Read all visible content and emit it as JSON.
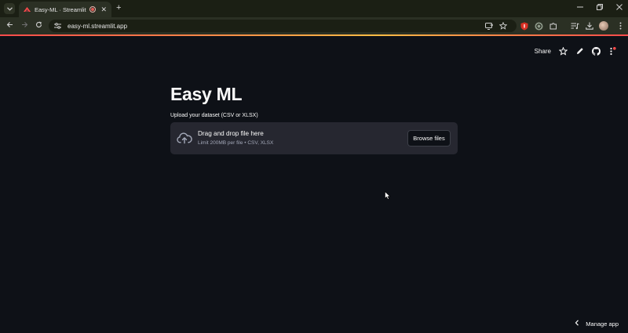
{
  "browser": {
    "tab_title": "Easy-ML · Streamlit",
    "url": "easy-ml.streamlit.app",
    "new_tab_symbol": "+",
    "close_symbol": "✕"
  },
  "app": {
    "header": {
      "share_label": "Share"
    },
    "title": "Easy ML",
    "uploader": {
      "label": "Upload your dataset (CSV or XLSX)",
      "primary_text": "Drag and drop file here",
      "secondary_text": "Limit 200MB per file • CSV, XLSX",
      "button_label": "Browse files"
    },
    "footer": {
      "manage_label": "Manage app"
    }
  },
  "colors": {
    "background": "#0e1117",
    "surface": "#262730",
    "text": "#fafafa",
    "accent": "#ff4b4b"
  }
}
